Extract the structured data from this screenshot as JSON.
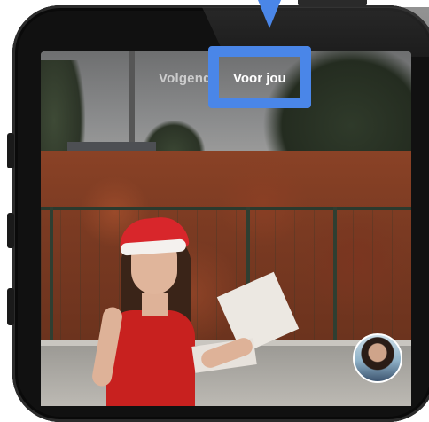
{
  "top_tabs": {
    "following": "Volgend",
    "for_you": "Voor jou"
  },
  "highlight": {
    "color": "#4a86e8"
  },
  "profile": {
    "avatar_icon": "profile-avatar"
  }
}
